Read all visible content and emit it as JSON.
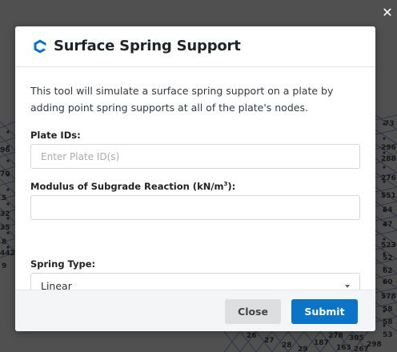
{
  "dialog": {
    "title": "Surface Spring Support",
    "description": "This tool will simulate a surface spring support on a plate by adding point spring supports at all of the plate's nodes.",
    "close_icon": "close-icon",
    "brand_icon": "skyciv-logo-icon",
    "accent_color": "#0b74c7"
  },
  "fields": {
    "plate_ids": {
      "label": "Plate IDs:",
      "placeholder": "Enter Plate ID(s)",
      "value": ""
    },
    "modulus": {
      "label_main": "Modulus of Subgrade Reaction (kN/m",
      "label_sup": "3",
      "label_end": "):",
      "value": ""
    },
    "spring_type": {
      "label": "Spring Type:",
      "selected": "Linear"
    }
  },
  "footer": {
    "close_label": "Close",
    "submit_label": "Submit"
  },
  "background": {
    "left_nodes": [
      "96",
      "70",
      "5",
      "32",
      "35",
      "8",
      "442",
      "9"
    ],
    "right_nodes": [
      "73",
      "296",
      "288",
      "276",
      "551",
      "54",
      "47",
      "523",
      "52",
      "62",
      "60",
      "578",
      "58",
      "58",
      "53"
    ],
    "bottom_nodes": [
      "26",
      "27",
      "28",
      "29",
      "187",
      "163",
      "305",
      "298",
      "278",
      "267"
    ]
  }
}
